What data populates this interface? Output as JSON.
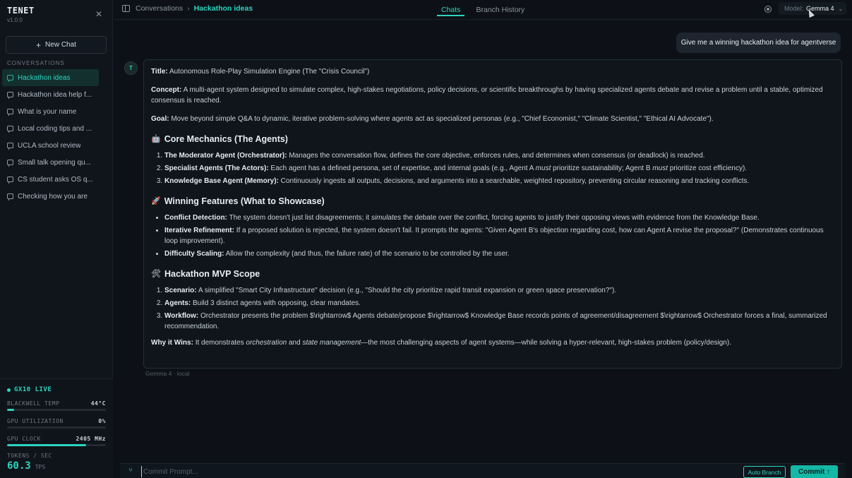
{
  "app": {
    "name": "TENET",
    "version": "v1.0.0"
  },
  "sidebar": {
    "new_chat_label": "New Chat",
    "section_label": "CONVERSATIONS",
    "items": [
      {
        "label": "Hackathon ideas",
        "active": true
      },
      {
        "label": "Hackathon idea help f..."
      },
      {
        "label": "What is your name"
      },
      {
        "label": "Local coding tips and ..."
      },
      {
        "label": "UCLA school review"
      },
      {
        "label": "Small talk opening qu..."
      },
      {
        "label": "CS student asks OS q..."
      },
      {
        "label": "Checking how you are"
      }
    ]
  },
  "stats": {
    "live_label": "GX10 LIVE",
    "temp": {
      "label": "BLACKWELL TEMP",
      "value": "44°C",
      "fraction": 0.07
    },
    "util": {
      "label": "GPU UTILIZATION",
      "value": "0%",
      "fraction": 0.0
    },
    "clock": {
      "label": "GPU CLOCK",
      "value": "2405 MHz",
      "fraction": 0.8
    },
    "tokens": {
      "label": "TOKENS / SEC",
      "value": "60.3",
      "unit": "TPS"
    }
  },
  "header": {
    "breadcrumb_root": "Conversations",
    "breadcrumb_sep": "›",
    "breadcrumb_current": "Hackathon ideas",
    "tabs": [
      {
        "label": "Chats",
        "active": true
      },
      {
        "label": "Branch History"
      }
    ],
    "model_label": "Model:",
    "model_value": "Gemma 4"
  },
  "chat": {
    "user_message": "Give me a winning hackathon idea for agentverse",
    "avatar_letter": "T",
    "answer": {
      "title_label": "Title:",
      "title_text": "Autonomous Role-Play Simulation Engine (The \"Crisis Council\")",
      "concept_label": "Concept:",
      "concept_text": "A multi-agent system designed to simulate complex, high-stakes negotiations, policy decisions, or scientific breakthroughs by having specialized agents debate and revise a problem until a stable, optimized consensus is reached.",
      "goal_label": "Goal:",
      "goal_text": "Move beyond simple Q&A to dynamic, iterative problem-solving where agents act as specialized personas (e.g., \"Chief Economist,\" \"Climate Scientist,\" \"Ethical AI Advocate\").",
      "h1": "Core Mechanics (The Agents)",
      "mech": [
        {
          "b": "The Moderator Agent (Orchestrator):",
          "t": "Manages the conversation flow, defines the core objective, enforces rules, and determines when consensus (or deadlock) is reached."
        },
        {
          "b": "Specialist Agents (The Actors):",
          "t1": "Each agent has a defined persona, set of expertise, and internal goals (e.g., Agent A",
          "i1": "must",
          "t2": "prioritize sustainability; Agent B",
          "i2": "must",
          "t3": "prioritize cost efficiency)."
        },
        {
          "b": "Knowledge Base Agent (Memory):",
          "t": "Continuously ingests all outputs, decisions, and arguments into a searchable, weighted repository, preventing circular reasoning and tracking conflicts."
        }
      ],
      "h2": "Winning Features (What to Showcase)",
      "features": [
        {
          "b": "Conflict Detection:",
          "t1": "The system doesn't just list disagreements; it",
          "i": "simulates",
          "t2": "the debate over the conflict, forcing agents to justify their opposing views with evidence from the Knowledge Base."
        },
        {
          "b": "Iterative Refinement:",
          "t": "If a proposed solution is rejected, the system doesn't fail. It prompts the agents: \"Given Agent B's objection regarding cost, how can Agent A revise the proposal?\" (Demonstrates continuous loop improvement)."
        },
        {
          "b": "Difficulty Scaling:",
          "t": "Allow the complexity (and thus, the failure rate) of the scenario to be controlled by the user."
        }
      ],
      "h3": "Hackathon MVP Scope",
      "mvp": [
        {
          "b": "Scenario:",
          "t": "A simplified \"Smart City Infrastructure\" decision (e.g., \"Should the city prioritize rapid transit expansion or green space preservation?\")."
        },
        {
          "b": "Agents:",
          "t": "Build 3 distinct agents with opposing, clear mandates."
        },
        {
          "b": "Workflow:",
          "t": "Orchestrator presents the problem $\\rightarrow$ Agents debate/propose $\\rightarrow$ Knowledge Base records points of agreement/disagreement $\\rightarrow$ Orchestrator forces a final, summarized recommendation."
        }
      ],
      "why_label": "Why it Wins:",
      "why_t1": "It demonstrates",
      "why_i1": "orchestration",
      "why_t2": "and",
      "why_i2": "state management",
      "why_t3": "—the most challenging aspects of agent systems—while solving a hyper-relevant, high-stakes problem (policy/design)."
    },
    "meta": "Gemma 4 · local"
  },
  "composer": {
    "placeholder": "Commit Prompt...",
    "auto_branch_label": "Auto Branch",
    "commit_label": "Commit ↑"
  },
  "colors": {
    "accent": "#2dd4bf",
    "background": "#0d1117",
    "sidebar": "#10151c"
  }
}
